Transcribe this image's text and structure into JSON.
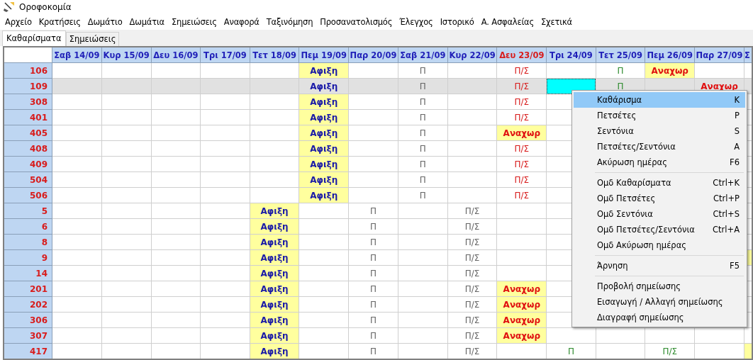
{
  "window": {
    "title": "Οροφοκομία"
  },
  "menu_bar": [
    "Αρχείο",
    "Κρατήσεις",
    "Δωμάτιο",
    "Δωμάτια",
    "Σημειώσεις",
    "Αναφορά",
    "Ταξινόμηση",
    "Προσανατολισμός",
    "Έλεγχος",
    "Ιστορικό",
    "Α. Ασφαλείας",
    "Σχετικά"
  ],
  "tabs": [
    {
      "label": "Καθαρίσματα",
      "selected": true
    },
    {
      "label": "Σημειώσεις",
      "selected": false
    }
  ],
  "table": {
    "columns": [
      {
        "label": "Σαβ 14/09",
        "holiday": false
      },
      {
        "label": "Κυρ 15/09",
        "holiday": false
      },
      {
        "label": "Δευ 16/09",
        "holiday": false
      },
      {
        "label": "Τρι 17/09",
        "holiday": false
      },
      {
        "label": "Τετ 18/09",
        "holiday": false
      },
      {
        "label": "Πεμ 19/09",
        "holiday": false
      },
      {
        "label": "Παρ 20/09",
        "holiday": false
      },
      {
        "label": "Σαβ 21/09",
        "holiday": false
      },
      {
        "label": "Κυρ 22/09",
        "holiday": false
      },
      {
        "label": "Δευ 23/09",
        "holiday": true
      },
      {
        "label": "Τρι 24/09",
        "holiday": false
      },
      {
        "label": "Τετ 25/09",
        "holiday": false
      },
      {
        "label": "Πεμ 26/09",
        "holiday": false
      },
      {
        "label": "Παρ 27/09",
        "holiday": false
      },
      {
        "label": "Σ",
        "holiday": false
      }
    ],
    "rows": [
      {
        "room": "106",
        "selected": false,
        "cells": [
          {},
          {},
          {},
          {},
          {},
          {
            "kind": "arrival",
            "text": "Αφιξη"
          },
          {},
          {
            "kind": "plain",
            "text": "Π"
          },
          {},
          {
            "kind": "due",
            "text": "Π/Σ"
          },
          {},
          {
            "kind": "done",
            "text": "Π"
          },
          {
            "kind": "departure",
            "text": "Αναχωρ"
          },
          {},
          {}
        ]
      },
      {
        "room": "109",
        "selected": true,
        "cells": [
          {},
          {},
          {},
          {},
          {},
          {
            "kind": "arrival",
            "text": "Αφιξη"
          },
          {},
          {
            "kind": "plain",
            "text": "Π"
          },
          {},
          {
            "kind": "due",
            "text": "Π/Σ"
          },
          {
            "focused": true
          },
          {
            "kind": "done",
            "text": "Π"
          },
          {},
          {
            "kind": "departure",
            "text": "Αναχωρ"
          },
          {}
        ]
      },
      {
        "room": "308",
        "selected": false,
        "cells": [
          {},
          {},
          {},
          {},
          {},
          {
            "kind": "arrival",
            "text": "Αφιξη"
          },
          {},
          {
            "kind": "plain",
            "text": "Π"
          },
          {},
          {
            "kind": "due",
            "text": "Π/Σ"
          },
          {},
          {},
          {},
          {},
          {}
        ]
      },
      {
        "room": "401",
        "selected": false,
        "cells": [
          {},
          {},
          {},
          {},
          {},
          {
            "kind": "arrival",
            "text": "Αφιξη"
          },
          {},
          {
            "kind": "plain",
            "text": "Π"
          },
          {},
          {
            "kind": "due",
            "text": "Π/Σ"
          },
          {},
          {},
          {},
          {},
          {}
        ]
      },
      {
        "room": "405",
        "selected": false,
        "cells": [
          {},
          {},
          {},
          {},
          {},
          {
            "kind": "arrival",
            "text": "Αφιξη"
          },
          {},
          {
            "kind": "plain",
            "text": "Π"
          },
          {},
          {
            "kind": "departure",
            "text": "Αναχωρ"
          },
          {},
          {},
          {},
          {},
          {}
        ]
      },
      {
        "room": "408",
        "selected": false,
        "cells": [
          {},
          {},
          {},
          {},
          {},
          {
            "kind": "arrival",
            "text": "Αφιξη"
          },
          {},
          {
            "kind": "plain",
            "text": "Π"
          },
          {},
          {
            "kind": "due",
            "text": "Π/Σ"
          },
          {},
          {},
          {},
          {},
          {}
        ]
      },
      {
        "room": "409",
        "selected": false,
        "cells": [
          {},
          {},
          {},
          {},
          {},
          {
            "kind": "arrival",
            "text": "Αφιξη"
          },
          {},
          {
            "kind": "plain",
            "text": "Π"
          },
          {},
          {
            "kind": "due",
            "text": "Π/Σ"
          },
          {},
          {},
          {},
          {},
          {}
        ]
      },
      {
        "room": "504",
        "selected": false,
        "cells": [
          {},
          {},
          {},
          {},
          {},
          {
            "kind": "arrival",
            "text": "Αφιξη"
          },
          {},
          {
            "kind": "plain",
            "text": "Π"
          },
          {},
          {
            "kind": "due",
            "text": "Π/Σ"
          },
          {},
          {},
          {},
          {},
          {}
        ]
      },
      {
        "room": "506",
        "selected": false,
        "cells": [
          {},
          {},
          {},
          {},
          {},
          {
            "kind": "arrival",
            "text": "Αφιξη"
          },
          {},
          {
            "kind": "plain",
            "text": "Π"
          },
          {},
          {
            "kind": "due",
            "text": "Π/Σ"
          },
          {},
          {},
          {},
          {},
          {}
        ]
      },
      {
        "room": "5",
        "selected": false,
        "cells": [
          {},
          {},
          {},
          {},
          {
            "kind": "arrival",
            "text": "Αφιξη"
          },
          {},
          {
            "kind": "plain",
            "text": "Π"
          },
          {},
          {
            "kind": "plain",
            "text": "Π/Σ"
          },
          {},
          {},
          {},
          {},
          {},
          {}
        ]
      },
      {
        "room": "6",
        "selected": false,
        "cells": [
          {},
          {},
          {},
          {},
          {
            "kind": "arrival",
            "text": "Αφιξη"
          },
          {},
          {
            "kind": "plain",
            "text": "Π"
          },
          {},
          {
            "kind": "plain",
            "text": "Π/Σ"
          },
          {},
          {},
          {},
          {},
          {},
          {}
        ]
      },
      {
        "room": "8",
        "selected": false,
        "cells": [
          {},
          {},
          {},
          {},
          {
            "kind": "arrival",
            "text": "Αφιξη"
          },
          {},
          {
            "kind": "plain",
            "text": "Π"
          },
          {},
          {
            "kind": "plain",
            "text": "Π/Σ"
          },
          {},
          {},
          {},
          {},
          {},
          {}
        ]
      },
      {
        "room": "9",
        "selected": false,
        "cells": [
          {},
          {},
          {},
          {},
          {
            "kind": "arrival",
            "text": "Αφιξη"
          },
          {},
          {
            "kind": "plain",
            "text": "Π"
          },
          {},
          {
            "kind": "plain",
            "text": "Π/Σ"
          },
          {},
          {},
          {},
          {},
          {},
          {
            "kind": "marked"
          }
        ]
      },
      {
        "room": "14",
        "selected": false,
        "cells": [
          {},
          {},
          {},
          {},
          {
            "kind": "arrival",
            "text": "Αφιξη"
          },
          {},
          {
            "kind": "plain",
            "text": "Π"
          },
          {},
          {
            "kind": "plain",
            "text": "Π/Σ"
          },
          {},
          {},
          {},
          {},
          {},
          {}
        ]
      },
      {
        "room": "201",
        "selected": false,
        "cells": [
          {},
          {},
          {},
          {},
          {
            "kind": "arrival",
            "text": "Αφιξη"
          },
          {},
          {
            "kind": "plain",
            "text": "Π"
          },
          {},
          {
            "kind": "plain",
            "text": "Π/Σ"
          },
          {
            "kind": "departure",
            "text": "Αναχωρ"
          },
          {},
          {},
          {},
          {},
          {}
        ]
      },
      {
        "room": "202",
        "selected": false,
        "cells": [
          {},
          {},
          {},
          {},
          {
            "kind": "arrival",
            "text": "Αφιξη"
          },
          {},
          {
            "kind": "plain",
            "text": "Π"
          },
          {},
          {
            "kind": "plain",
            "text": "Π/Σ"
          },
          {
            "kind": "departure",
            "text": "Αναχωρ"
          },
          {},
          {},
          {},
          {},
          {}
        ]
      },
      {
        "room": "306",
        "selected": false,
        "cells": [
          {},
          {},
          {},
          {},
          {
            "kind": "arrival",
            "text": "Αφιξη"
          },
          {},
          {
            "kind": "plain",
            "text": "Π"
          },
          {},
          {
            "kind": "plain",
            "text": "Π/Σ"
          },
          {
            "kind": "departure",
            "text": "Αναχωρ"
          },
          {},
          {},
          {},
          {},
          {}
        ]
      },
      {
        "room": "307",
        "selected": false,
        "cells": [
          {},
          {},
          {},
          {},
          {
            "kind": "arrival",
            "text": "Αφιξη"
          },
          {},
          {
            "kind": "plain",
            "text": "Π"
          },
          {},
          {
            "kind": "plain",
            "text": "Π/Σ"
          },
          {
            "kind": "departure",
            "text": "Αναχωρ"
          },
          {},
          {},
          {},
          {},
          {}
        ]
      },
      {
        "room": "417",
        "selected": false,
        "cells": [
          {},
          {},
          {},
          {},
          {
            "kind": "arrival",
            "text": "Αφιξη"
          },
          {},
          {
            "kind": "plain",
            "text": "Π"
          },
          {},
          {
            "kind": "plain",
            "text": "Π/Σ"
          },
          {},
          {
            "kind": "done",
            "text": "Π"
          },
          {},
          {
            "kind": "done",
            "text": "Π/Σ"
          },
          {},
          {
            "kind": "marked"
          }
        ]
      }
    ]
  },
  "context_menu": {
    "groups": [
      {
        "items": [
          {
            "label": "Καθάρισμα",
            "shortcut": "K",
            "selected": true
          },
          {
            "label": "Πετσέτες",
            "shortcut": "P",
            "selected": false
          },
          {
            "label": "Σεντόνια",
            "shortcut": "S",
            "selected": false
          },
          {
            "label": "Πετσέτες/Σεντόνια",
            "shortcut": "A",
            "selected": false
          },
          {
            "label": "Ακύρωση ημέρας",
            "shortcut": "F6",
            "selected": false
          }
        ]
      },
      {
        "items": [
          {
            "label": "Ομδ Καθαρίσματα",
            "shortcut": "Ctrl+K",
            "selected": false
          },
          {
            "label": "Ομδ Πετσέτες",
            "shortcut": "Ctrl+P",
            "selected": false
          },
          {
            "label": "Ομδ Σεντόνια",
            "shortcut": "Ctrl+S",
            "selected": false
          },
          {
            "label": "Ομδ Πετσέτες/Σεντόνια",
            "shortcut": "Ctrl+A",
            "selected": false
          },
          {
            "label": "Ομδ Ακύρωση ημέρας",
            "selected": false
          }
        ]
      },
      {
        "items": [
          {
            "label": "Άρνηση",
            "shortcut": "F5",
            "selected": false
          }
        ]
      },
      {
        "items": [
          {
            "label": "Προβολή σημείωσης",
            "selected": false
          },
          {
            "label": "Εισαγωγή / Αλλαγή σημείωσης",
            "selected": false
          },
          {
            "label": "Διαγραφή σημείωσης",
            "selected": false
          }
        ]
      }
    ]
  }
}
